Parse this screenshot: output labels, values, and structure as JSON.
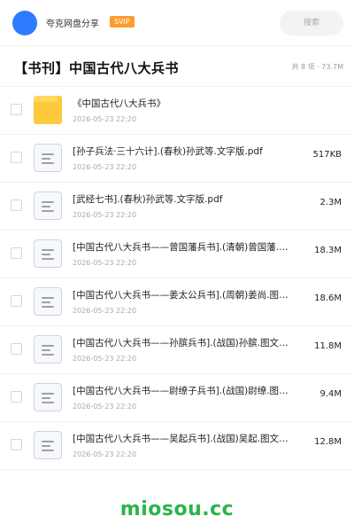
{
  "header": {
    "username": "夸克网盘分享",
    "badge": "SVIP",
    "search_placeholder": "搜索"
  },
  "folder": {
    "title": "【书刊】中国古代八大兵书",
    "meta": "共 8 项 · 73.7M"
  },
  "files": [
    {
      "type": "folder",
      "icon": "folder-icon",
      "name": "《中国古代八大兵书》",
      "date": "2026-05-23 22:20",
      "size": ""
    },
    {
      "type": "file",
      "icon": "document-icon",
      "name": "[孙子兵法·三十六计].(春秋)孙武等.文字版.pdf",
      "date": "2026-05-23 22:20",
      "size": "517KB"
    },
    {
      "type": "file",
      "icon": "document-icon",
      "name": "[武经七书].(春秋)孙武等.文字版.pdf",
      "date": "2026-05-23 22:20",
      "size": "2.3M"
    },
    {
      "type": "file",
      "icon": "document-icon",
      "name": "[中国古代八大兵书——曾国藩兵书].(清朝)曾国藩.图文版.pdf",
      "date": "2026-05-23 22:20",
      "size": "18.3M"
    },
    {
      "type": "file",
      "icon": "document-icon",
      "name": "[中国古代八大兵书——姜太公兵书].(周朝)姜尚.图文版.pdf",
      "date": "2026-05-23 22:20",
      "size": "18.6M"
    },
    {
      "type": "file",
      "icon": "document-icon",
      "name": "[中国古代八大兵书——孙膑兵书].(战国)孙膑.图文版.pdf",
      "date": "2026-05-23 22:20",
      "size": "11.8M"
    },
    {
      "type": "file",
      "icon": "document-icon",
      "name": "[中国古代八大兵书——尉缭子兵书].(战国)尉缭.图文版.pdf",
      "date": "2026-05-23 22:20",
      "size": "9.4M"
    },
    {
      "type": "file",
      "icon": "document-icon",
      "name": "[中国古代八大兵书——吴起兵书].(战国)吴起.图文版.pdf",
      "date": "2026-05-23 22:20",
      "size": "12.8M"
    }
  ],
  "watermark": "miosou.cc",
  "colors": {
    "accent": "#2f7bff",
    "badge": "#ff9a2e",
    "folder": "#ffc93c",
    "watermark": "#2ab44a"
  }
}
